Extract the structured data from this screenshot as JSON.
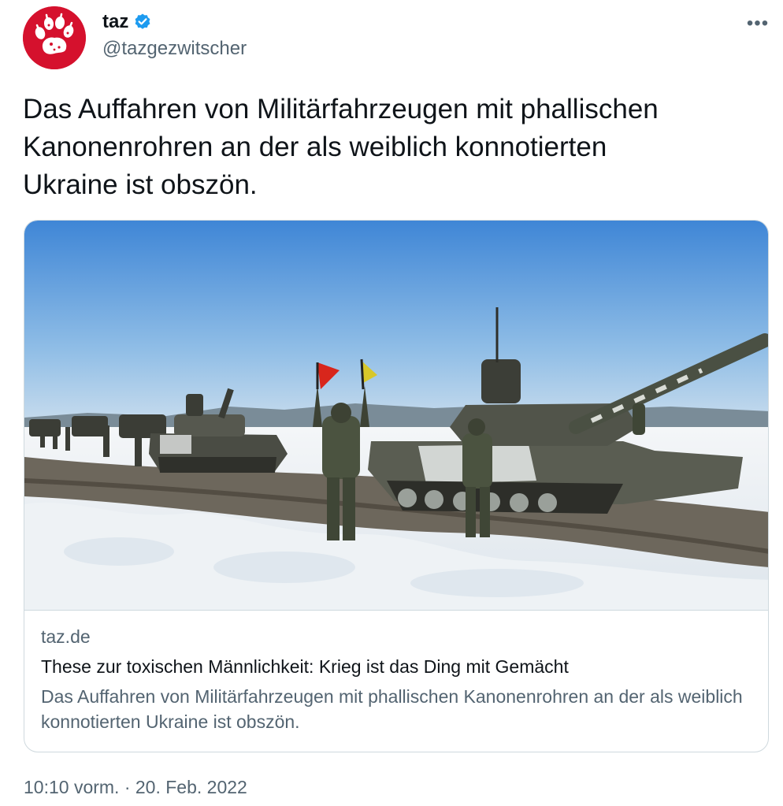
{
  "account": {
    "display_name": "taz",
    "handle": "@tazgezwitscher",
    "verified": true,
    "avatar_color": "#d5112d"
  },
  "menu": {
    "more_label": "•••"
  },
  "tweet": {
    "text": "Das Auffahren von Militärfahrzeugen mit phallischen\nKanonenrohren an der als weiblich konnotierten\nUkraine ist obszön."
  },
  "card": {
    "domain": "taz.de",
    "title": "These zur toxischen Männlichkeit: Krieg ist das Ding mit Gemächt",
    "description": "Das Auffahren von Militärfahrzeugen mit phallischen Kanonenrohren an der als weiblich konnotierten Ukraine ist obszön."
  },
  "footer": {
    "timestamp": "10:10 vorm. · 20. Feb. 2022"
  },
  "colors": {
    "accent_blue": "#1d9bf0",
    "secondary_text": "#536471",
    "border": "#cfd9de"
  },
  "icons": {
    "avatar": "paw-print-logo",
    "verified": "verified-badge-icon",
    "more": "more-icon"
  }
}
